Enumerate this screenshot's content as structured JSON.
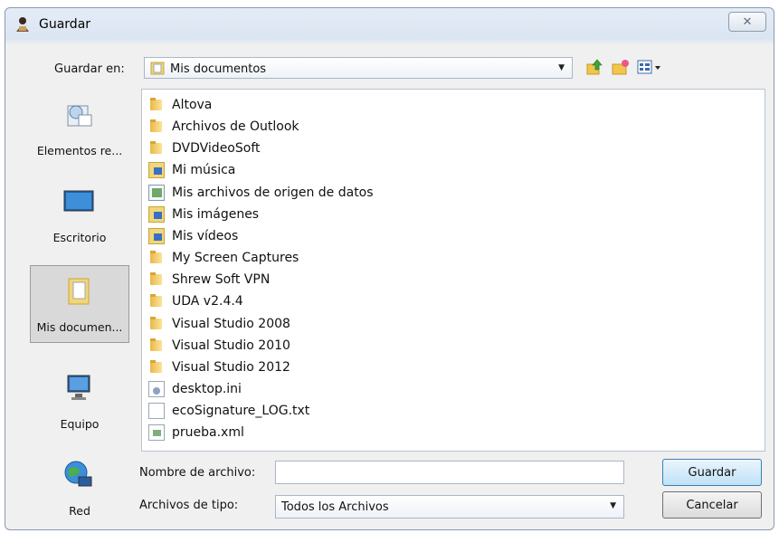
{
  "window": {
    "title": "Guardar",
    "close_glyph": "✕"
  },
  "save_in": {
    "label": "Guardar en:",
    "value": "Mis documentos",
    "icon": "documents-folder-icon"
  },
  "toolbar": {
    "up_icon": "up-folder-icon",
    "new_folder_icon": "new-folder-icon",
    "views_icon": "views-menu-icon"
  },
  "places": [
    {
      "label": "Elementos re...",
      "icon": "recent-items-icon",
      "selected": false
    },
    {
      "label": "Escritorio",
      "icon": "desktop-icon",
      "selected": false
    },
    {
      "label": "Mis documen...",
      "icon": "documents-icon",
      "selected": true
    },
    {
      "label": "Equipo",
      "icon": "computer-icon",
      "selected": false
    },
    {
      "label": "Red",
      "icon": "network-icon",
      "selected": false
    }
  ],
  "files": [
    {
      "name": "Altova",
      "type": "folder"
    },
    {
      "name": "Archivos de Outlook",
      "type": "folder"
    },
    {
      "name": "DVDVideoSoft",
      "type": "folder"
    },
    {
      "name": "Mi música",
      "type": "special"
    },
    {
      "name": "Mis archivos de origen de datos",
      "type": "db"
    },
    {
      "name": "Mis imágenes",
      "type": "special"
    },
    {
      "name": "Mis vídeos",
      "type": "special"
    },
    {
      "name": "My Screen Captures",
      "type": "folder"
    },
    {
      "name": "Shrew Soft VPN",
      "type": "folder"
    },
    {
      "name": "UDA v2.4.4",
      "type": "folder"
    },
    {
      "name": "Visual Studio 2008",
      "type": "folder"
    },
    {
      "name": "Visual Studio 2010",
      "type": "folder"
    },
    {
      "name": "Visual Studio 2012",
      "type": "folder"
    },
    {
      "name": "desktop.ini",
      "type": "ini"
    },
    {
      "name": "ecoSignature_LOG.txt",
      "type": "txt"
    },
    {
      "name": "prueba.xml",
      "type": "xml"
    }
  ],
  "filename": {
    "label": "Nombre de archivo:",
    "value": ""
  },
  "filetype": {
    "label": "Archivos de tipo:",
    "value": "Todos los Archivos"
  },
  "buttons": {
    "save": "Guardar",
    "cancel": "Cancelar"
  }
}
